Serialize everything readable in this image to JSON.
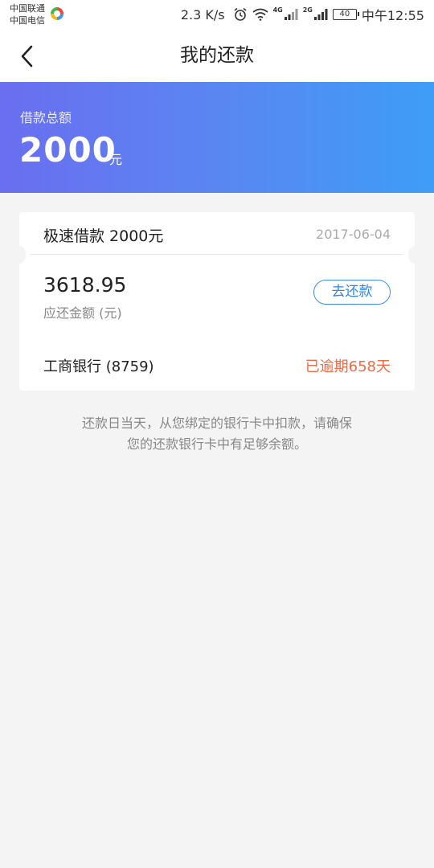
{
  "status_bar": {
    "carrier_1": "中国联通",
    "carrier_2": "中国电信",
    "speed": "2.3 K/s",
    "network_1": "4G",
    "network_2": "2G",
    "battery": "40",
    "time": "中午12:55",
    "icons": [
      "carrier-logo-icon",
      "alarm-icon",
      "wifi-icon",
      "signal-icon",
      "battery-icon"
    ]
  },
  "nav": {
    "title": "我的还款",
    "back_icon": "chevron-left-icon"
  },
  "banner": {
    "label": "借款总额",
    "amount": "2000",
    "unit": "元",
    "gradient_colors": [
      "#6a6ef0",
      "#3d9df7"
    ]
  },
  "loan_card": {
    "title": "极速借款 2000元",
    "date": "2017-06-04",
    "due_amount": "3618.95",
    "due_label": "应还金额 (元)",
    "repay_button": "去还款",
    "bank": "工商银行 (8759)",
    "overdue_status": "已逾期658天",
    "accent_color": "#2f86e6",
    "overdue_color": "#f06a45"
  },
  "note": {
    "line_1": "还款日当天，从您绑定的银行卡中扣款，请确保",
    "line_2": "您的还款银行卡中有足够余额。"
  }
}
